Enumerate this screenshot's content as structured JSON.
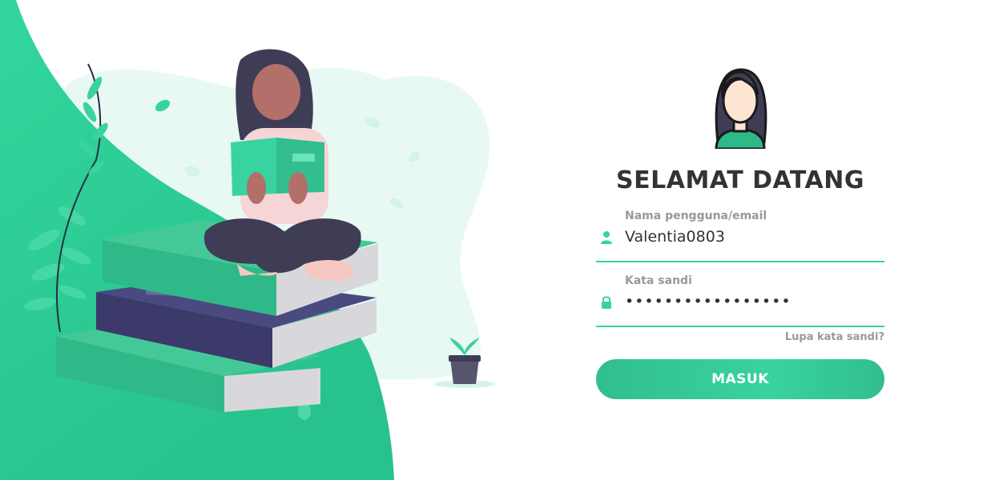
{
  "login": {
    "title": "SELAMAT DATANG",
    "username": {
      "label": "Nama pengguna/email",
      "value": "Valentia0803",
      "icon": "user-icon"
    },
    "password": {
      "label": "Kata sandi",
      "value": "•••••••••••••••••",
      "icon": "lock-icon"
    },
    "forgot_link": "Lupa kata sandi?",
    "submit_label": "MASUK",
    "avatar_icon": "woman-avatar-icon"
  },
  "colors": {
    "accent": "#38d39f",
    "accent_dark": "#32be8f",
    "text": "#333333",
    "muted": "#999999",
    "books_dark": "#3b3a6b"
  }
}
